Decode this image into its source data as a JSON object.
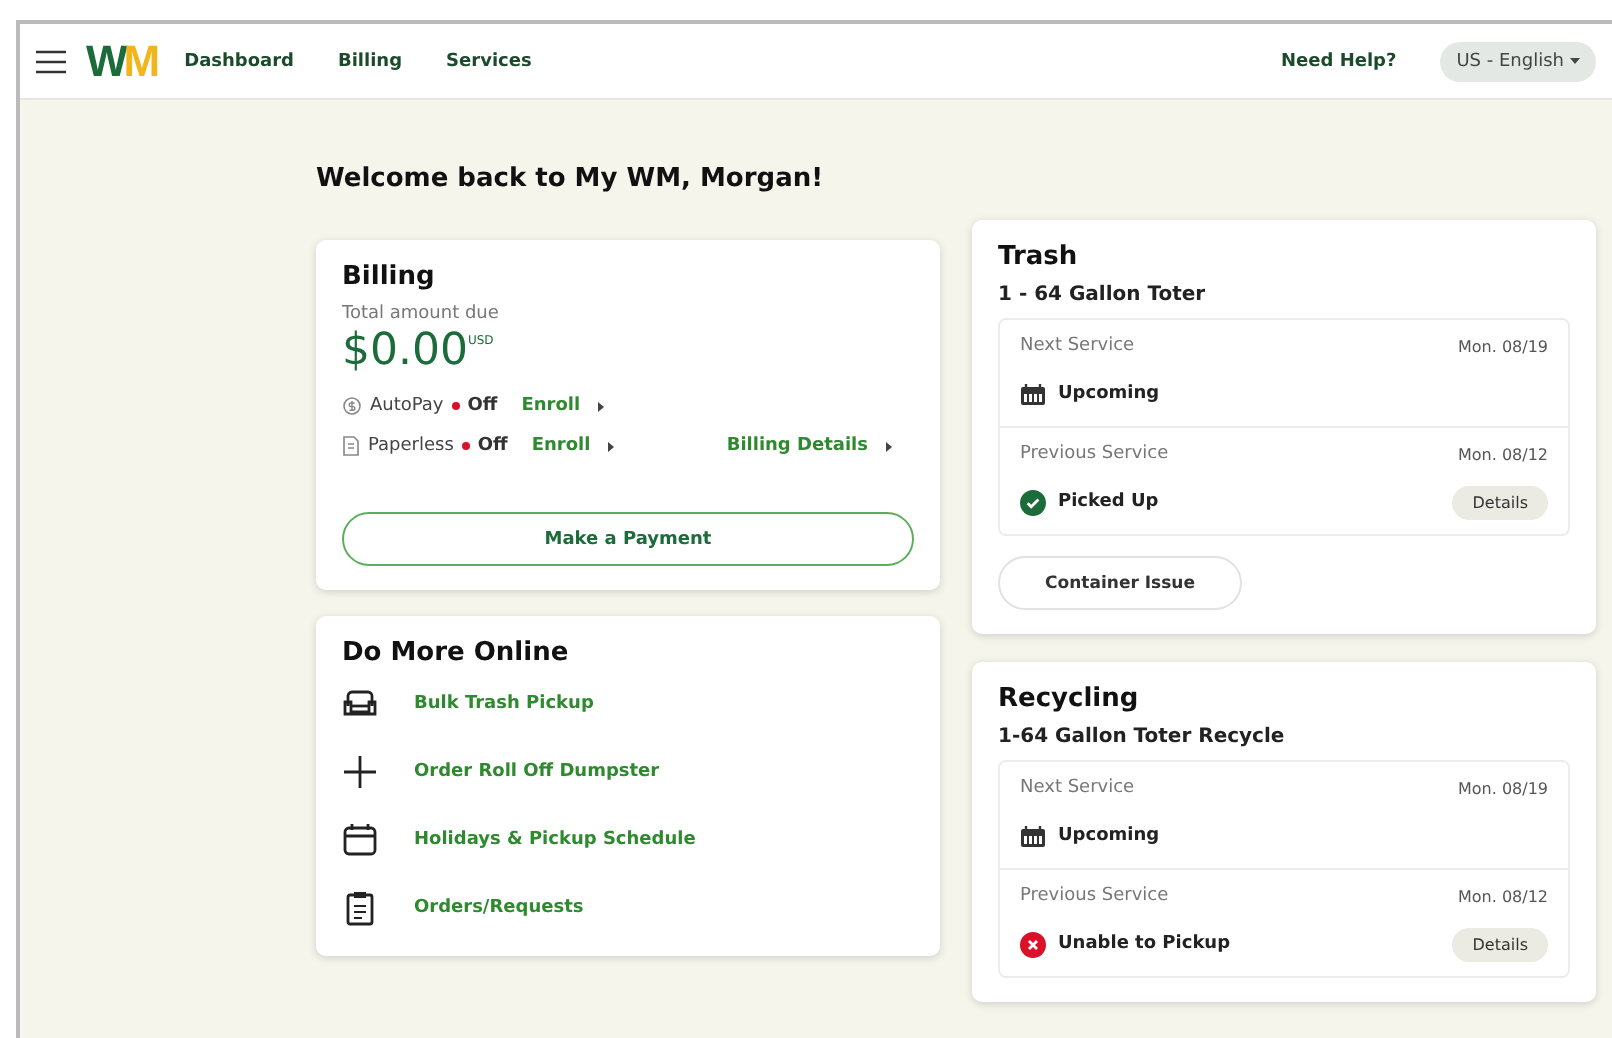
{
  "header": {
    "logo": "WM",
    "nav": [
      {
        "label": "Dashboard"
      },
      {
        "label": "Billing"
      },
      {
        "label": "Services"
      }
    ],
    "help": "Need Help?",
    "language": "US - English"
  },
  "welcome": "Welcome back to My WM, Morgan!",
  "billing": {
    "title": "Billing",
    "amount_label": "Total amount due",
    "amount": "$0.00",
    "currency": "USD",
    "settings": [
      {
        "kind": "autopay",
        "label": "AutoPay",
        "on": false,
        "status": "Off",
        "action": "Enroll"
      },
      {
        "kind": "paperless",
        "label": "Paperless",
        "on": false,
        "status": "Off",
        "action": "Enroll"
      }
    ],
    "details_link": "Billing Details",
    "pay_button": "Make a Payment"
  },
  "more": {
    "title": "Do More Online",
    "links": [
      {
        "kind": "couch",
        "label": "Bulk Trash Pickup"
      },
      {
        "kind": "plus",
        "label": "Order Roll Off Dumpster"
      },
      {
        "kind": "calendar",
        "label": "Holidays & Pickup Schedule"
      },
      {
        "kind": "clipboard",
        "label": "Orders/Requests"
      }
    ]
  },
  "services": [
    {
      "title": "Trash",
      "container": "1 - 64 Gallon Toter",
      "entries": [
        {
          "label": "Next Service",
          "date": "Mon. 08/19",
          "kind": "upcoming",
          "status": "Upcoming"
        },
        {
          "label": "Previous Service",
          "date": "Mon. 08/12",
          "kind": "done",
          "status": "Picked Up",
          "details": "Details"
        }
      ],
      "issue_button": "Container Issue"
    },
    {
      "title": "Recycling",
      "container": "1-64 Gallon Toter Recycle",
      "entries": [
        {
          "label": "Next Service",
          "date": "Mon. 08/19",
          "kind": "upcoming",
          "status": "Upcoming"
        },
        {
          "label": "Previous Service",
          "date": "Mon. 08/12",
          "kind": "failed",
          "status": "Unable to Pickup",
          "details": "Details"
        }
      ]
    }
  ]
}
